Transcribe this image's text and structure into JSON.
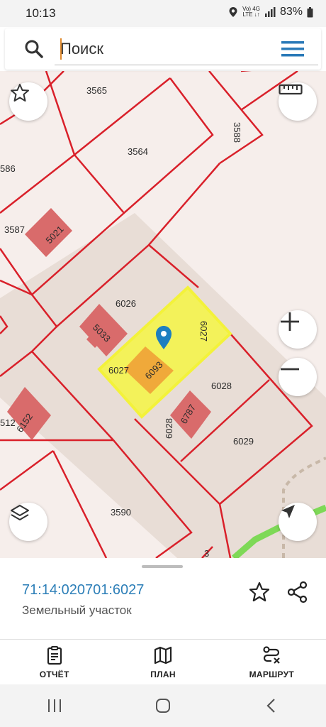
{
  "status_bar": {
    "time": "10:13",
    "network_top": "Vo) 4G",
    "network_bottom": "LTE ↓↑",
    "battery": "83%"
  },
  "search": {
    "placeholder": "Поиск",
    "icon": "search-icon"
  },
  "map": {
    "parcel_labels": [
      "3565",
      "3564",
      "3588",
      "586",
      "3587",
      "5021",
      "6026",
      "5033",
      "6027",
      "6027",
      "6093",
      "6028",
      "6028",
      "6787",
      "6029",
      "512",
      "6152",
      "3590",
      "3"
    ],
    "selected_color": "#f3f25a",
    "boundary_color": "#d9202a",
    "building_color": "#d96b6b",
    "controls": [
      "star-icon",
      "ruler-icon",
      "zoom-in-icon",
      "zoom-out-icon",
      "layers-icon",
      "navigate-icon"
    ]
  },
  "details": {
    "cadastral_number": "71:14:020701:6027",
    "object_type": "Земельный участок"
  },
  "bottom_nav": {
    "items": [
      {
        "label": "ОТЧЁТ",
        "icon": "report-icon"
      },
      {
        "label": "ПЛАН",
        "icon": "map-icon"
      },
      {
        "label": "МАРШРУТ",
        "icon": "route-icon"
      }
    ]
  },
  "system_nav": [
    "recent-apps-icon",
    "home-icon",
    "back-icon"
  ]
}
